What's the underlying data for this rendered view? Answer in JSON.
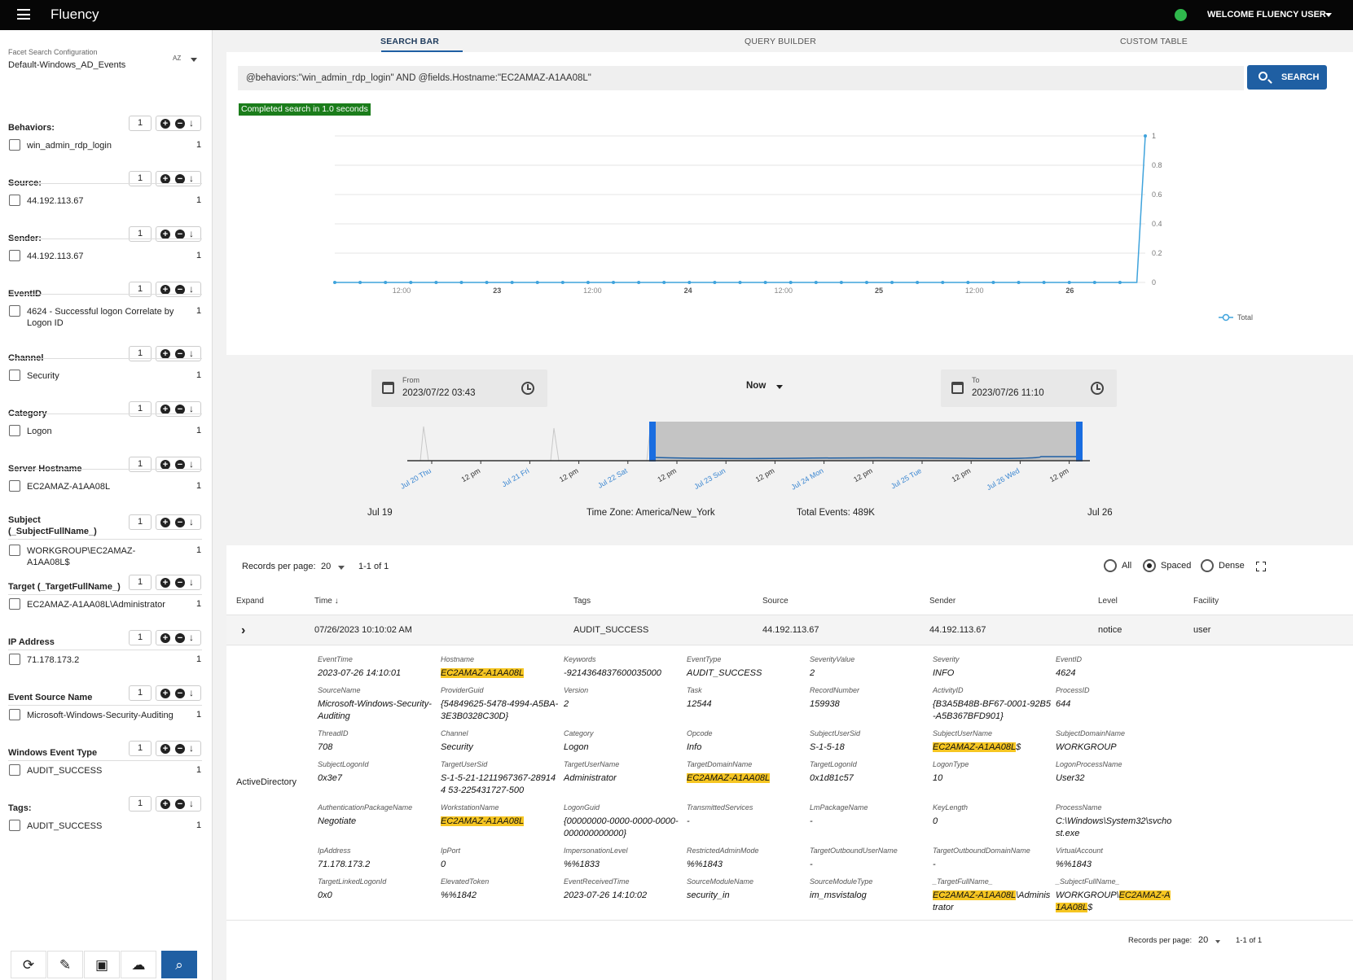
{
  "app": {
    "title": "Fluency",
    "welcome": "WELCOME FLUENCY USER",
    "status_color": "#2fb84c"
  },
  "sidebar": {
    "config_label": "Facet Search Configuration",
    "config_value": "Default-Windows_AD_Events",
    "sort_label": "AZ",
    "facets": [
      {
        "title": "Behaviors:",
        "num": "1",
        "value": "win_admin_rdp_login",
        "count": "1"
      },
      {
        "title": "Source:",
        "num": "1",
        "value": "44.192.113.67",
        "count": "1"
      },
      {
        "title": "Sender:",
        "num": "1",
        "value": "44.192.113.67",
        "count": "1"
      },
      {
        "title": "EventID",
        "num": "1",
        "value": "4624 - Successful logon Correlate by Logon ID",
        "count": "1"
      },
      {
        "title": "Channel",
        "num": "1",
        "value": "Security",
        "count": "1"
      },
      {
        "title": "Category",
        "num": "1",
        "value": "Logon",
        "count": "1"
      },
      {
        "title": "Server Hostname",
        "num": "1",
        "value": "EC2AMAZ-A1AA08L",
        "count": "1"
      },
      {
        "title": "Subject (_SubjectFullName_)",
        "num": "1",
        "value": "WORKGROUP\\EC2AMAZ-A1AA08L$",
        "count": "1"
      },
      {
        "title": "Target (_TargetFullName_)",
        "num": "1",
        "value": "EC2AMAZ-A1AA08L\\Administrator",
        "count": "1"
      },
      {
        "title": "IP Address",
        "num": "1",
        "value": "71.178.173.2",
        "count": "1"
      },
      {
        "title": "Event Source Name",
        "num": "1",
        "value": "Microsoft-Windows-Security-Auditing",
        "count": "1"
      },
      {
        "title": "Windows Event Type",
        "num": "1",
        "value": "AUDIT_SUCCESS",
        "count": "1"
      },
      {
        "title": "Tags:",
        "num": "1",
        "value": "AUDIT_SUCCESS",
        "count": "1"
      }
    ],
    "toolbar_icons": [
      "refresh-icon",
      "edit-icon",
      "save-icon",
      "cloud-download-icon",
      "search-icon"
    ]
  },
  "tabs": [
    "SEARCH BAR",
    "QUERY BUILDER",
    "CUSTOM TABLE"
  ],
  "search": {
    "query": "@behaviors:\"win_admin_rdp_login\" AND @fields.Hostname:\"EC2AMAZ-A1AA08L\"",
    "button": "SEARCH",
    "status": "Completed search in 1.0 seconds"
  },
  "chart_data": {
    "type": "line",
    "x_tick_labels": [
      "12:00",
      "23",
      "12:00",
      "24",
      "12:00",
      "25",
      "12:00",
      "26"
    ],
    "y_tick_labels": [
      "0",
      "0.2",
      "0.4",
      "0.6",
      "0.8",
      "1"
    ],
    "ylim": [
      0,
      1
    ],
    "series": [
      {
        "name": "Total",
        "color": "#3fa3dc",
        "values": [
          0,
          0,
          0,
          0,
          0,
          0,
          0,
          0,
          0,
          0,
          0,
          0,
          0,
          0,
          0,
          0,
          0,
          0,
          0,
          0,
          0,
          0,
          0,
          0,
          0,
          0,
          0,
          0,
          0,
          0,
          0,
          0,
          0,
          0,
          0,
          0,
          0,
          0,
          0,
          0,
          0,
          0,
          0,
          0,
          0,
          0,
          0,
          0,
          0,
          0,
          0,
          0,
          0,
          0,
          0,
          0,
          0,
          0,
          0,
          0,
          0,
          0,
          0,
          0,
          0,
          0,
          0,
          0,
          0,
          0,
          0,
          0,
          0,
          0,
          0,
          0,
          0,
          0,
          0,
          0,
          0,
          0,
          0,
          0,
          0,
          0,
          0,
          0,
          0,
          0,
          0,
          0,
          0,
          0,
          0,
          0,
          1
        ]
      }
    ],
    "legend_position": "bottom-right",
    "grid": true
  },
  "range": {
    "from_label": "From",
    "from_value": "2023/07/22 03:43",
    "to_label": "To",
    "to_value": "2023/07/26 11:10",
    "now": "Now",
    "brush_ticks": [
      "Jul 20 Thu",
      "12 pm",
      "Jul 21 Fri",
      "12 pm",
      "Jul 22 Sat",
      "12 pm",
      "Jul 23 Sun",
      "12 pm",
      "Jul 24 Mon",
      "12 pm",
      "Jul 25 Tue",
      "12 pm",
      "Jul 26 Wed",
      "12 pm"
    ],
    "start_label": "Jul 19",
    "end_label": "Jul 26",
    "timezone": "Time Zone: America/New_York",
    "total": "Total Events: 489K"
  },
  "results": {
    "rpp_label": "Records per page:",
    "rpp_value": "20",
    "range": "1-1 of 1",
    "view_options": [
      "All",
      "Spaced",
      "Dense"
    ],
    "selected_view": "Spaced",
    "columns": [
      "Expand",
      "Time",
      "Tags",
      "Source",
      "Sender",
      "Level",
      "Facility"
    ],
    "row": {
      "time": "07/26/2023 10:10:02 AM",
      "tags": "AUDIT_SUCCESS",
      "source": "44.192.113.67",
      "sender": "44.192.113.67",
      "level": "notice",
      "facility": "user"
    },
    "detail_group": "ActiveDirectory",
    "fields": [
      {
        "k": "EventTime",
        "v": "2023-07-26 14:10:01"
      },
      {
        "k": "Hostname",
        "v": "EC2AMAZ-A1AA08L",
        "hl": true
      },
      {
        "k": "Keywords",
        "v": "-9214364837600035000"
      },
      {
        "k": "EventType",
        "v": "AUDIT_SUCCESS"
      },
      {
        "k": "SeverityValue",
        "v": "2"
      },
      {
        "k": "Severity",
        "v": "INFO"
      },
      {
        "k": "EventID",
        "v": "4624"
      },
      {
        "k": "SourceName",
        "v": "Microsoft-Windows-Security-Auditing"
      },
      {
        "k": "ProviderGuid",
        "v": "{54849625-5478-4994-A5BA-3E3B0328C30D}"
      },
      {
        "k": "Version",
        "v": "2"
      },
      {
        "k": "Task",
        "v": "12544"
      },
      {
        "k": "RecordNumber",
        "v": "159938"
      },
      {
        "k": "ActivityID",
        "v": "{B3A5B48B-BF67-0001-92B5-A5B367BFD901}"
      },
      {
        "k": "ProcessID",
        "v": "644"
      },
      {
        "k": "ThreadID",
        "v": "708"
      },
      {
        "k": "Channel",
        "v": "Security"
      },
      {
        "k": "Category",
        "v": "Logon"
      },
      {
        "k": "Opcode",
        "v": "Info"
      },
      {
        "k": "SubjectUserSid",
        "v": "S-1-5-18"
      },
      {
        "k": "SubjectUserName",
        "v": "EC2AMAZ-A1AA08L",
        "hl": true,
        "suffix": "$"
      },
      {
        "k": "SubjectDomainName",
        "v": "WORKGROUP"
      },
      {
        "k": "SubjectLogonId",
        "v": "0x3e7"
      },
      {
        "k": "TargetUserSid",
        "v": "S-1-5-21-1211967367-289144 53-225431727-500"
      },
      {
        "k": "TargetUserName",
        "v": "Administrator"
      },
      {
        "k": "TargetDomainName",
        "v": "EC2AMAZ-A1AA08L",
        "hl": true
      },
      {
        "k": "TargetLogonId",
        "v": "0x1d81c57"
      },
      {
        "k": "LogonType",
        "v": "10"
      },
      {
        "k": "LogonProcessName",
        "v": "User32"
      },
      {
        "k": "AuthenticationPackageName",
        "v": "Negotiate"
      },
      {
        "k": "WorkstationName",
        "v": "EC2AMAZ-A1AA08L",
        "hl": true
      },
      {
        "k": "LogonGuid",
        "v": "{00000000-0000-0000-0000-000000000000}"
      },
      {
        "k": "TransmittedServices",
        "v": "-"
      },
      {
        "k": "LmPackageName",
        "v": "-"
      },
      {
        "k": "KeyLength",
        "v": "0"
      },
      {
        "k": "ProcessName",
        "v": "C:\\Windows\\System32\\svchost.exe"
      },
      {
        "k": "IpAddress",
        "v": "71.178.173.2"
      },
      {
        "k": "IpPort",
        "v": "0"
      },
      {
        "k": "ImpersonationLevel",
        "v": "%%1833"
      },
      {
        "k": "RestrictedAdminMode",
        "v": "%%1843"
      },
      {
        "k": "TargetOutboundUserName",
        "v": "-"
      },
      {
        "k": "TargetOutboundDomainName",
        "v": "-"
      },
      {
        "k": "VirtualAccount",
        "v": "%%1843"
      },
      {
        "k": "TargetLinkedLogonId",
        "v": "0x0"
      },
      {
        "k": "ElevatedToken",
        "v": "%%1842"
      },
      {
        "k": "EventReceivedTime",
        "v": "2023-07-26 14:10:02"
      },
      {
        "k": "SourceModuleName",
        "v": "security_in"
      },
      {
        "k": "SourceModuleType",
        "v": "im_msvistalog"
      },
      {
        "k": "_TargetFullName_",
        "v": "EC2AMAZ-A1AA08L",
        "hl": true,
        "suffix": "\\Administrator"
      },
      {
        "k": "_SubjectFullName_",
        "prefix": "WORKGROUP\\",
        "v": "EC2AMAZ-A1AA08L",
        "hl": true,
        "suffix": "$"
      }
    ],
    "footer_rpp_label": "Records per page:",
    "footer_rpp_value": "20",
    "footer_range": "1-1 of 1"
  }
}
